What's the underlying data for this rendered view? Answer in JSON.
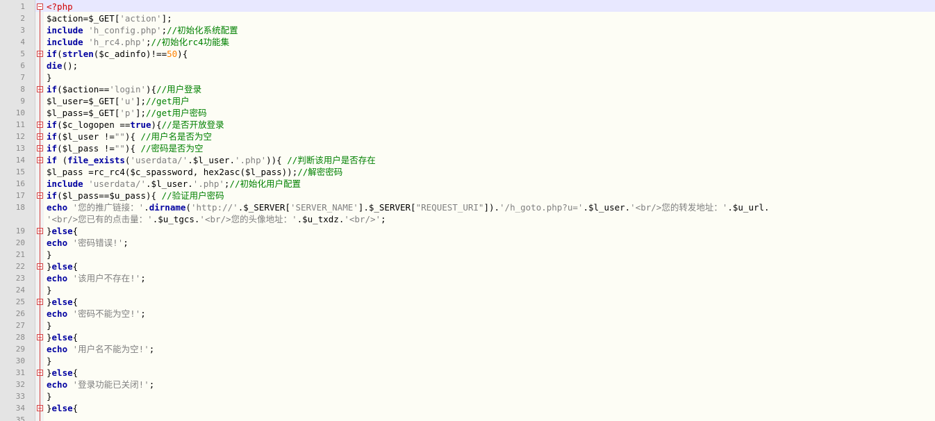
{
  "editor": {
    "lines": [
      {
        "no": "1",
        "segs": [
          [
            "tag",
            "<?php"
          ]
        ]
      },
      {
        "no": "2",
        "segs": [
          [
            "plain",
            "$action=$_GET["
          ],
          [
            "str",
            "'action'"
          ],
          [
            "plain",
            "];"
          ]
        ]
      },
      {
        "no": "3",
        "segs": [
          [
            "kw",
            "include "
          ],
          [
            "str",
            "'h_config.php'"
          ],
          [
            "plain",
            ";"
          ],
          [
            "cmt",
            "//初始化系统配置"
          ]
        ]
      },
      {
        "no": "4",
        "segs": [
          [
            "kw",
            "include "
          ],
          [
            "str",
            "'h_rc4.php'"
          ],
          [
            "plain",
            ";"
          ],
          [
            "cmt",
            "//初始化rc4功能集"
          ]
        ]
      },
      {
        "no": "5",
        "segs": [
          [
            "kw",
            "if"
          ],
          [
            "plain",
            "("
          ],
          [
            "kw",
            "strlen"
          ],
          [
            "plain",
            "($c_adinfo)!=="
          ],
          [
            "num",
            "50"
          ],
          [
            "plain",
            "){"
          ]
        ]
      },
      {
        "no": "6",
        "segs": [
          [
            "kw",
            "die"
          ],
          [
            "plain",
            "();"
          ]
        ]
      },
      {
        "no": "7",
        "segs": [
          [
            "plain",
            "}"
          ]
        ]
      },
      {
        "no": "8",
        "segs": [
          [
            "kw",
            "if"
          ],
          [
            "plain",
            "($action=="
          ],
          [
            "str",
            "'login'"
          ],
          [
            "plain",
            "){"
          ],
          [
            "cmt",
            "//用户登录"
          ]
        ]
      },
      {
        "no": "9",
        "segs": [
          [
            "plain",
            "$l_user=$_GET["
          ],
          [
            "str",
            "'u'"
          ],
          [
            "plain",
            "];"
          ],
          [
            "cmt",
            "//get用户"
          ]
        ]
      },
      {
        "no": "10",
        "segs": [
          [
            "plain",
            "$l_pass=$_GET["
          ],
          [
            "str",
            "'p'"
          ],
          [
            "plain",
            "];"
          ],
          [
            "cmt",
            "//get用户密码"
          ]
        ]
      },
      {
        "no": "11",
        "segs": [
          [
            "kw",
            "if"
          ],
          [
            "plain",
            "($c_logopen =="
          ],
          [
            "kw",
            "true"
          ],
          [
            "plain",
            "){"
          ],
          [
            "cmt",
            "//是否开放登录"
          ]
        ]
      },
      {
        "no": "12",
        "segs": [
          [
            "kw",
            "if"
          ],
          [
            "plain",
            "($l_user !="
          ],
          [
            "str",
            "\"\""
          ],
          [
            "plain",
            "){ "
          ],
          [
            "cmt",
            "//用户名是否为空"
          ]
        ]
      },
      {
        "no": "13",
        "segs": [
          [
            "kw",
            "if"
          ],
          [
            "plain",
            "($l_pass !="
          ],
          [
            "str",
            "\"\""
          ],
          [
            "plain",
            "){ "
          ],
          [
            "cmt",
            "//密码是否为空"
          ]
        ]
      },
      {
        "no": "14",
        "segs": [
          [
            "kw",
            "if "
          ],
          [
            "plain",
            "("
          ],
          [
            "kw",
            "file_exists"
          ],
          [
            "plain",
            "("
          ],
          [
            "str",
            "'userdata/'"
          ],
          [
            "plain",
            ".$l_user."
          ],
          [
            "str",
            "'.php'"
          ],
          [
            "plain",
            ")){ "
          ],
          [
            "cmt",
            "//判断该用户是否存在"
          ]
        ]
      },
      {
        "no": "15",
        "segs": [
          [
            "plain",
            "$l_pass =rc_rc4($c_spassword, hex2asc($l_pass));"
          ],
          [
            "cmt",
            "//解密密码"
          ]
        ]
      },
      {
        "no": "16",
        "segs": [
          [
            "kw",
            "include "
          ],
          [
            "str",
            "'userdata/'"
          ],
          [
            "plain",
            ".$l_user."
          ],
          [
            "str",
            "'.php'"
          ],
          [
            "plain",
            ";"
          ],
          [
            "cmt",
            "//初始化用户配置"
          ]
        ]
      },
      {
        "no": "17",
        "segs": [
          [
            "kw",
            "if"
          ],
          [
            "plain",
            "($l_pass==$u_pass){ "
          ],
          [
            "cmt",
            "//验证用户密码"
          ]
        ]
      },
      {
        "no": "18",
        "segs": [
          [
            "kw",
            "echo "
          ],
          [
            "str",
            "'您的推广链接：'"
          ],
          [
            "plain",
            "."
          ],
          [
            "kw",
            "dirname"
          ],
          [
            "plain",
            "("
          ],
          [
            "str",
            "'http://'"
          ],
          [
            "plain",
            ".$_SERVER["
          ],
          [
            "str",
            "'SERVER_NAME'"
          ],
          [
            "plain",
            "].$_SERVER["
          ],
          [
            "str",
            "\"REQUEST_URI\""
          ],
          [
            "plain",
            "])."
          ],
          [
            "str",
            "'/h_goto.php?u='"
          ],
          [
            "plain",
            ".$l_user."
          ],
          [
            "str",
            "'<br/>您的转发地址：'"
          ],
          [
            "plain",
            ".$u_url."
          ]
        ]
      },
      {
        "no": "",
        "segs": [
          [
            "str",
            "'<br/>您已有的点击量：'"
          ],
          [
            "plain",
            ".$u_tgcs."
          ],
          [
            "str",
            "'<br/>您的头像地址：'"
          ],
          [
            "plain",
            ".$u_txdz."
          ],
          [
            "str",
            "'<br/>'"
          ],
          [
            "plain",
            ";"
          ]
        ]
      },
      {
        "no": "19",
        "segs": [
          [
            "plain",
            "}"
          ],
          [
            "kw",
            "else"
          ],
          [
            "plain",
            "{"
          ]
        ]
      },
      {
        "no": "20",
        "segs": [
          [
            "kw",
            "echo "
          ],
          [
            "str",
            "'密码错误!'"
          ],
          [
            "plain",
            ";"
          ]
        ]
      },
      {
        "no": "21",
        "segs": [
          [
            "plain",
            "}"
          ]
        ]
      },
      {
        "no": "22",
        "segs": [
          [
            "plain",
            "}"
          ],
          [
            "kw",
            "else"
          ],
          [
            "plain",
            "{"
          ]
        ]
      },
      {
        "no": "23",
        "segs": [
          [
            "kw",
            "echo "
          ],
          [
            "str",
            "'该用户不存在!'"
          ],
          [
            "plain",
            ";"
          ]
        ]
      },
      {
        "no": "24",
        "segs": [
          [
            "plain",
            "}"
          ]
        ]
      },
      {
        "no": "25",
        "segs": [
          [
            "plain",
            "}"
          ],
          [
            "kw",
            "else"
          ],
          [
            "plain",
            "{"
          ]
        ]
      },
      {
        "no": "26",
        "segs": [
          [
            "kw",
            "echo "
          ],
          [
            "str",
            "'密码不能为空!'"
          ],
          [
            "plain",
            ";"
          ]
        ]
      },
      {
        "no": "27",
        "segs": [
          [
            "plain",
            "}"
          ]
        ]
      },
      {
        "no": "28",
        "segs": [
          [
            "plain",
            "}"
          ],
          [
            "kw",
            "else"
          ],
          [
            "plain",
            "{"
          ]
        ]
      },
      {
        "no": "29",
        "segs": [
          [
            "kw",
            "echo "
          ],
          [
            "str",
            "'用户名不能为空!'"
          ],
          [
            "plain",
            ";"
          ]
        ]
      },
      {
        "no": "30",
        "segs": [
          [
            "plain",
            "}"
          ]
        ]
      },
      {
        "no": "31",
        "segs": [
          [
            "plain",
            "}"
          ],
          [
            "kw",
            "else"
          ],
          [
            "plain",
            "{"
          ]
        ]
      },
      {
        "no": "32",
        "segs": [
          [
            "kw",
            "echo "
          ],
          [
            "str",
            "'登录功能已关闭!'"
          ],
          [
            "plain",
            ";"
          ]
        ]
      },
      {
        "no": "33",
        "segs": [
          [
            "plain",
            "}"
          ]
        ]
      },
      {
        "no": "34",
        "segs": [
          [
            "plain",
            "}"
          ],
          [
            "kw",
            "else"
          ],
          [
            "plain",
            "{"
          ]
        ]
      },
      {
        "no": "35",
        "segs": []
      }
    ]
  },
  "colors": {
    "keyword": "#0000a0",
    "string": "#808080",
    "comment": "#008000",
    "number": "#ff8000",
    "php_tag": "#d00000",
    "fold_marker": "#d24040"
  }
}
